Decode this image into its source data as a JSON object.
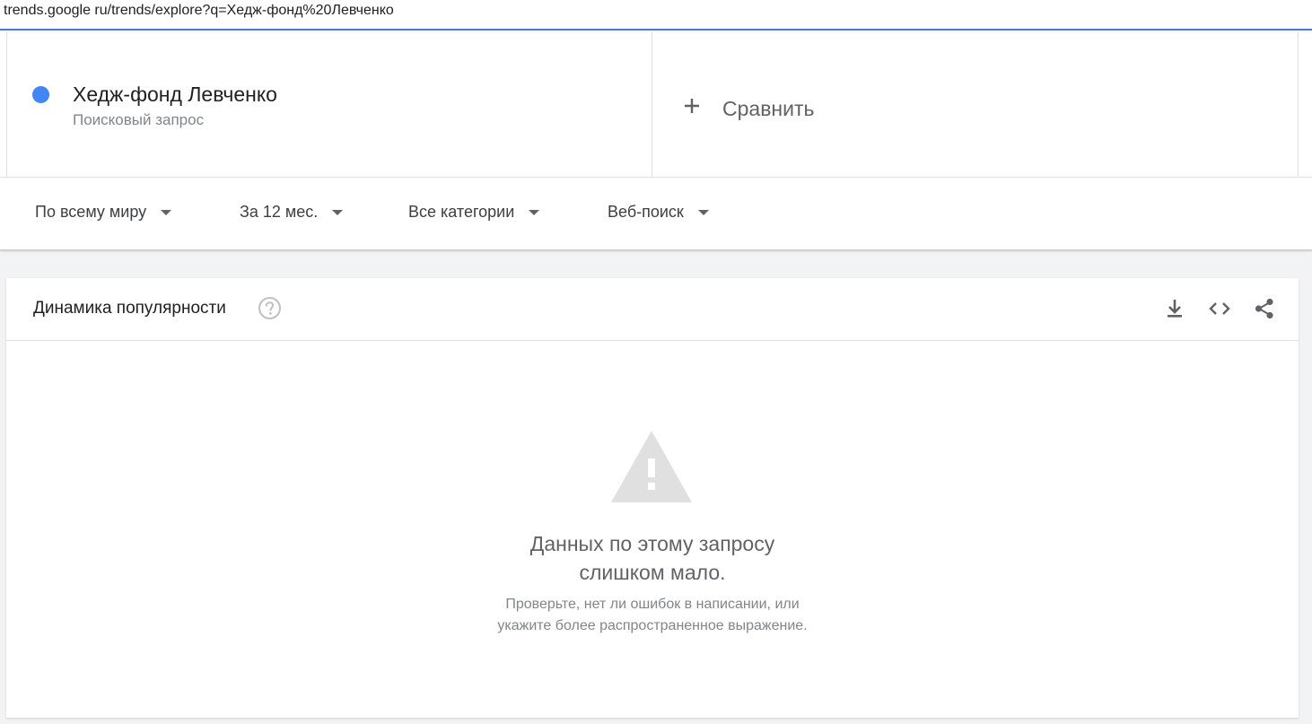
{
  "browser": {
    "url": "trends.google ru/trends/explore?q=Хедж-фонд%20Левченко"
  },
  "terms": {
    "term1": {
      "name": "Хедж-фонд Левченко",
      "type": "Поисковый запрос",
      "color": "#4285f4"
    },
    "compare_label": "Сравнить"
  },
  "filters": {
    "region": "По всему миру",
    "period": "За 12 мес.",
    "category": "Все категории",
    "search_type": "Веб-поиск"
  },
  "panel": {
    "title": "Динамика популярности",
    "icons": [
      "help-icon",
      "download-icon",
      "embed-code-icon",
      "share-icon"
    ],
    "empty": {
      "title_line1": "Данных по этому запросу",
      "title_line2": "слишком мало.",
      "sub_line1": "Проверьте, нет ли ошибок в написании, или",
      "sub_line2": "укажите более распространенное выражение."
    }
  }
}
